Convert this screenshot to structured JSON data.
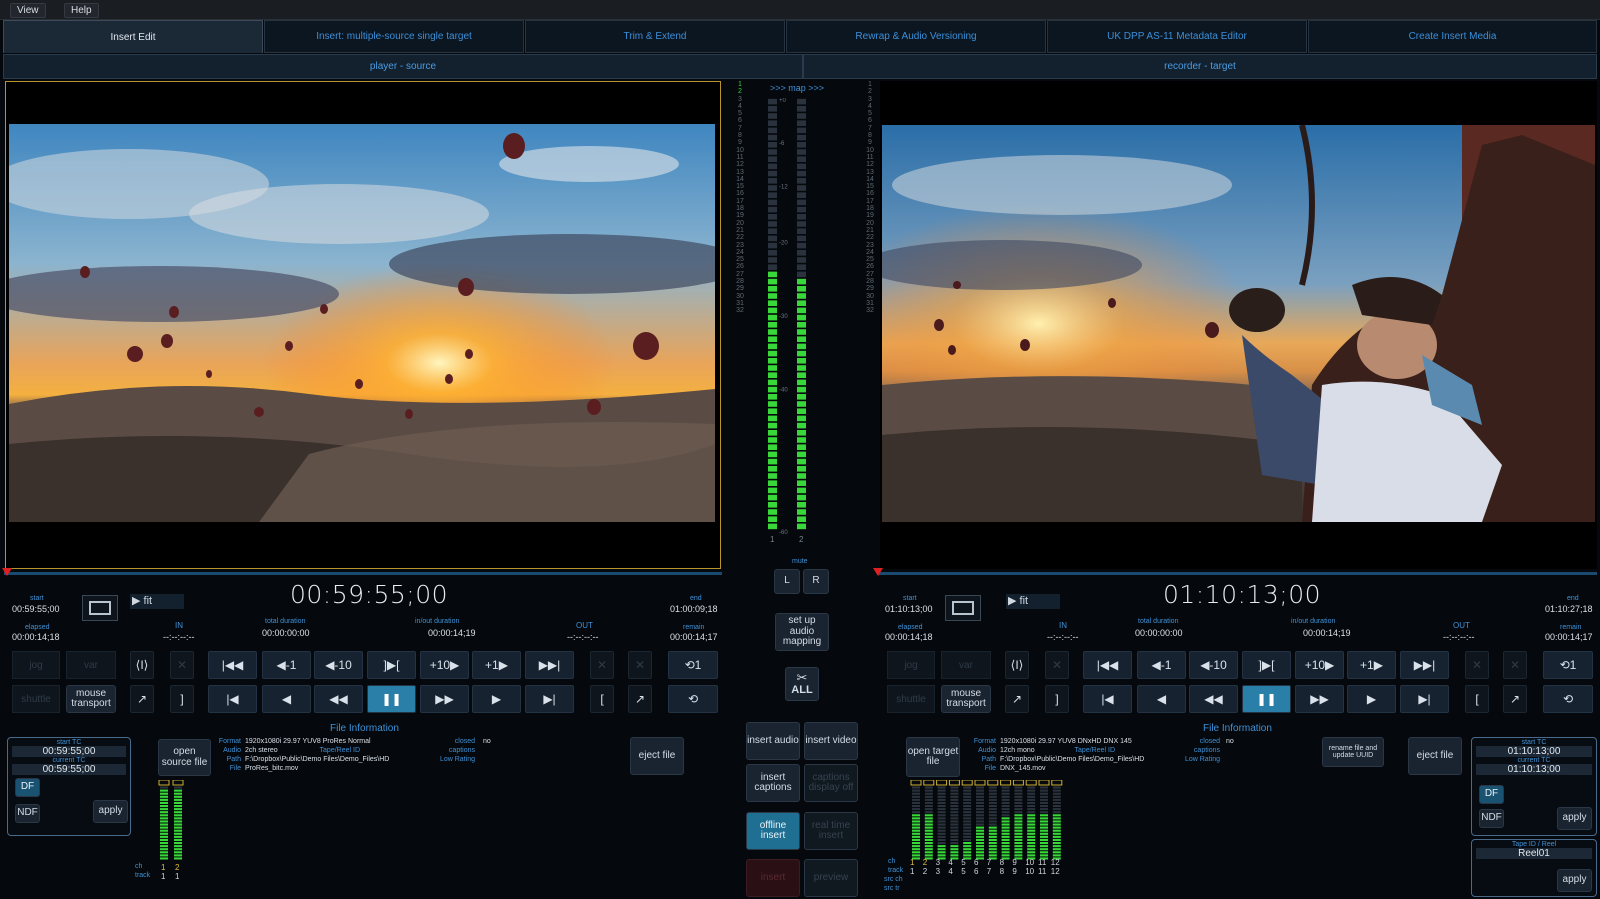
{
  "menu": [
    "View",
    "Help"
  ],
  "tabs": [
    "Insert Edit",
    "Insert: multiple-source single target",
    "Trim & Extend",
    "Rewrap & Audio Versioning",
    "UK DPP AS-11 Metadata Editor",
    "Create Insert Media"
  ],
  "player": {
    "header": "player - source",
    "timecode": "00:59:55;00",
    "start_label": "start",
    "start": "00:59:55;00",
    "elapsed_label": "elapsed",
    "elapsed": "00:00:14;18",
    "end_label": "end",
    "end": "01:00:09;18",
    "remain_label": "remain",
    "remain": "00:00:14;17",
    "in_label": "IN",
    "in": "--:--:--:--",
    "out_label": "OUT",
    "out": "--:--:--:--",
    "total_label": "total duration",
    "total": "00:00:00:00",
    "inout_label": "in/out duration",
    "inout": "00:00:14;19",
    "fit": "fit",
    "jog": "jog",
    "var": "var",
    "shuttle": "shuttle",
    "mouse_transport": "mouse transport",
    "file_info_title": "File Information",
    "info": {
      "format_l": "Format",
      "format": "1920x1080i 29.97 YUV8 ProRes Normal",
      "audio_l": "Audio",
      "audio": "2ch stereo",
      "path_l": "Path",
      "path": "F:\\Dropbox\\Public\\Demo Files\\Demo_Files\\HD",
      "file_l": "File",
      "file": "ProRes_bitc.mov",
      "closed_l": "closed",
      "closed": "no",
      "tape_l": "Tape/Reel ID",
      "captions_l": "captions",
      "lowrating_l": "Low Rating"
    },
    "open_btn": "open source file",
    "eject_btn": "eject file",
    "starttc_label": "start TC",
    "starttc": "00:59:55;00",
    "currenttc_label": "current TC",
    "currenttc": "00:59:55;00",
    "df": "DF",
    "ndf": "NDF",
    "apply": "apply",
    "ch_label": "ch",
    "track_label": "track",
    "channels": [
      "1",
      "2"
    ],
    "tracks": [
      "1",
      "1"
    ]
  },
  "recorder": {
    "header": "recorder - target",
    "timecode": "01:10:13;00",
    "start_label": "start",
    "start": "01:10:13;00",
    "elapsed_label": "elapsed",
    "elapsed": "00:00:14;18",
    "end_label": "end",
    "end": "01:10:27;18",
    "remain_label": "remain",
    "remain": "00:00:14;17",
    "in_label": "IN",
    "in": "--:--:--:--",
    "out_label": "OUT",
    "out": "--:--:--:--",
    "total_label": "total duration",
    "total": "00:00:00:00",
    "inout_label": "in/out duration",
    "inout": "00:00:14;19",
    "fit": "fit",
    "jog": "jog",
    "var": "var",
    "shuttle": "shuttle",
    "mouse_transport": "mouse transport",
    "file_info_title": "File Information",
    "info": {
      "format_l": "Format",
      "format": "1920x1080i 29.97 YUV8 DNxHD DNX 145",
      "audio_l": "Audio",
      "audio": "12ch mono",
      "path_l": "Path",
      "path": "F:\\Dropbox\\Public\\Demo Files\\Demo_Files\\HD",
      "file_l": "File",
      "file": "DNX_145.mov",
      "closed_l": "closed",
      "closed": "no",
      "tape_l": "Tape/Reel ID",
      "captions_l": "captions",
      "lowrating_l": "Low Rating"
    },
    "open_btn": "open target file",
    "rename_btn": "rename file and update UUID",
    "eject_btn": "eject file",
    "starttc_label": "start TC",
    "starttc": "01:10:13;00",
    "currenttc_label": "current TC",
    "currenttc": "01:10:13;00",
    "df": "DF",
    "ndf": "NDF",
    "apply": "apply",
    "tape_reel_label": "Tape ID / Reel",
    "tape_reel": "Reel01",
    "apply2": "apply",
    "ch_label": "ch",
    "track_label": "track",
    "srcch_label": "src ch",
    "srctr_label": "src tr",
    "channels": [
      "1",
      "2",
      "3",
      "4",
      "5",
      "6",
      "7",
      "8",
      "9",
      "10",
      "11",
      "12"
    ],
    "tracks": [
      "1",
      "2",
      "3",
      "4",
      "5",
      "6",
      "7",
      "8",
      "9",
      "10",
      "11",
      "12"
    ]
  },
  "center": {
    "map_label": ">>> map >>>",
    "db_ticks": [
      "+0",
      "-6",
      "-12",
      "-20",
      "-30",
      "-40",
      "-60"
    ],
    "meter_channels": [
      "1",
      "2"
    ],
    "meter_levels": [
      0.59,
      0.58
    ],
    "mute_label": "mute",
    "l": "L",
    "r": "R",
    "setup_audio": "set up audio mapping",
    "all": "ALL",
    "insert_audio": "insert audio",
    "insert_video": "insert video",
    "insert_captions": "insert captions",
    "captions_display": "captions display off",
    "offline_insert": "offline insert",
    "realtime_insert": "real time insert",
    "insert": "insert",
    "preview": "preview"
  },
  "levels": {
    "player": [
      0.92,
      0.92
    ],
    "recorder": [
      0.62,
      0.6,
      0.18,
      0.2,
      0.25,
      0.45,
      0.45,
      0.55,
      0.6,
      0.6,
      0.6,
      0.6
    ]
  }
}
